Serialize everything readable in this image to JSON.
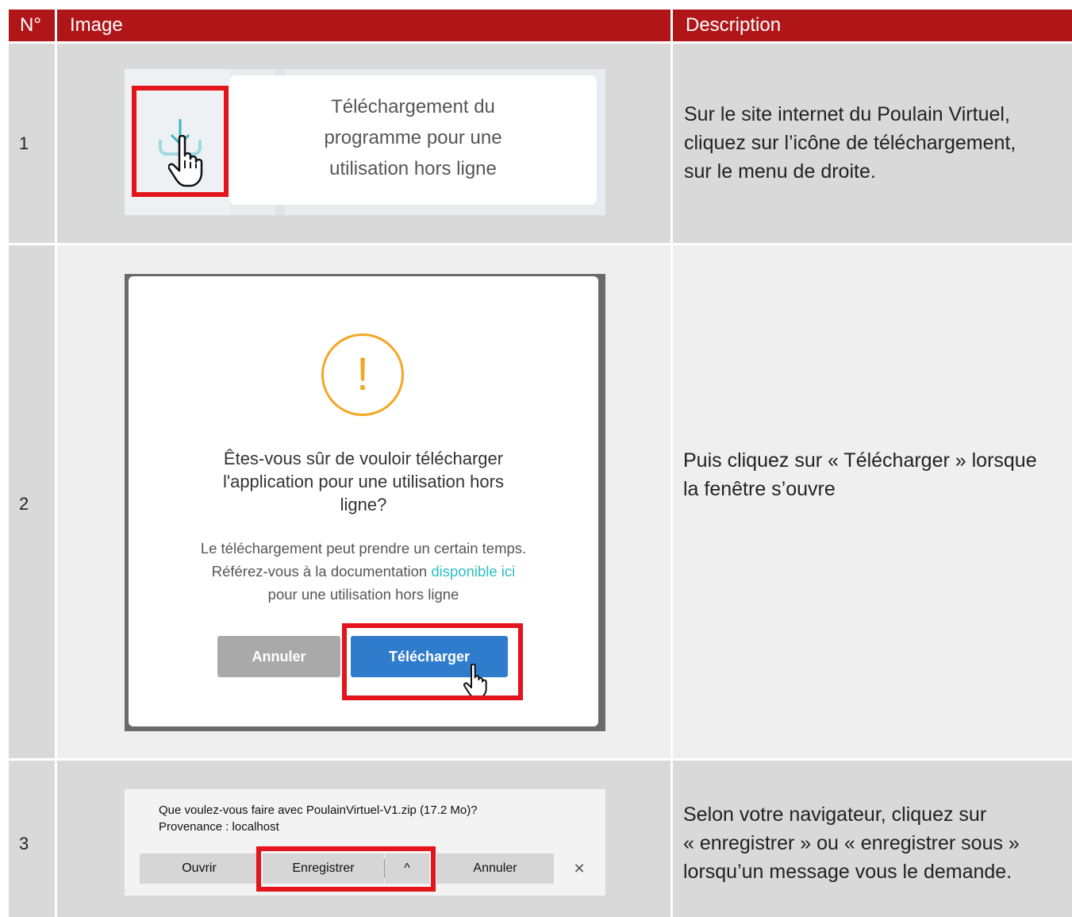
{
  "header": {
    "col_num": "N°",
    "col_image": "Image",
    "col_description": "Description"
  },
  "rows": [
    {
      "num": "1",
      "image": {
        "text_lines": [
          "Téléchargement du",
          "programme pour une",
          "utilisation hors ligne"
        ]
      },
      "description": [
        "Sur le site internet du Poulain Virtuel,",
        "cliquez sur l’icône de téléchargement,",
        "sur le menu de droite."
      ]
    },
    {
      "num": "2",
      "image": {
        "warning_symbol": "!",
        "title_lines": [
          "Êtes-vous sûr de vouloir télécharger",
          "l'application pour une utilisation hors",
          "ligne?"
        ],
        "body_line1": "Le téléchargement peut prendre un certain temps.",
        "body_line2_prefix": "Référez-vous à la documentation ",
        "body_link": "disponible ici",
        "body_line3": "pour une utilisation hors ligne",
        "cancel_label": "Annuler",
        "download_label": "Télécharger"
      },
      "description": [
        "Puis cliquez sur « Télécharger » lorsque",
        "la fenêtre s’ouvre"
      ]
    },
    {
      "num": "3",
      "image": {
        "question": "Que voulez-vous faire avec PoulainVirtuel-V1.zip (17.2 Mo)?",
        "source": "Provenance : localhost",
        "open_label": "Ouvrir",
        "save_label": "Enregistrer",
        "cancel_label": "Annuler",
        "close_symbol": "✕",
        "chevron_symbol": "^"
      },
      "description": [
        "Selon votre navigateur, cliquez sur",
        "« enregistrer » ou « enregistrer sous »",
        "lorsqu’un message vous le demande."
      ]
    }
  ],
  "colors": {
    "header": "#b01518",
    "highlight": "#e3141b",
    "primary_button": "#2f7ccc",
    "cancel_button": "#a9a9a9",
    "warning": "#f5a623",
    "link": "#2bbfc4"
  }
}
